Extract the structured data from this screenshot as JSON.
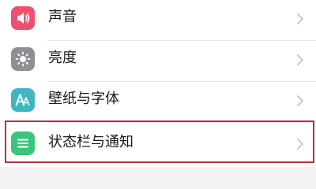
{
  "settings": {
    "items": [
      {
        "label": "声音",
        "icon": "speaker-icon",
        "icon_color": "#f0506e"
      },
      {
        "label": "亮度",
        "icon": "sun-icon",
        "icon_color": "#8e8e93"
      },
      {
        "label": "壁纸与字体",
        "icon": "font-aa-icon",
        "icon_color": "#3fb7c2"
      },
      {
        "label": "状态栏与通知",
        "icon": "list-icon",
        "icon_color": "#3cc47c"
      }
    ],
    "highlighted_item": "状态栏与通知",
    "highlight_color": "#b8323f"
  }
}
